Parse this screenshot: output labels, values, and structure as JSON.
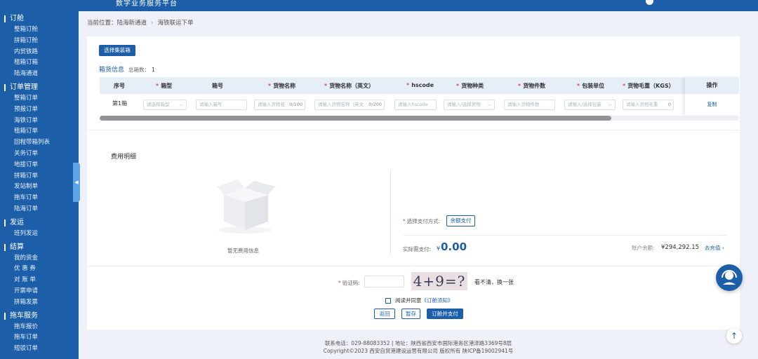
{
  "topbar": {
    "logo_text": "",
    "brand": "数字业务服务平台"
  },
  "sidebar": {
    "sections": [
      {
        "title": "订舱",
        "items": [
          "整箱订舱",
          "拼箱订舱",
          "内贸铁路",
          "租箱订箱",
          "陆海通道"
        ]
      },
      {
        "title": "订单管理",
        "items": [
          "整箱订单",
          "预报订单",
          "海铁订单",
          "租箱订单",
          "回程带箱列表",
          "关务订单",
          "地接订单",
          "拼箱订单",
          "发站制单",
          "拖车订单",
          "陆海订单"
        ]
      },
      {
        "title": "发运",
        "items": [
          "班列发运"
        ]
      },
      {
        "title": "结算",
        "items": [
          "我的资金",
          "优 惠 券",
          "对 账 单",
          "开票申请",
          "拼箱发票"
        ]
      },
      {
        "title": "拖车服务",
        "items": [
          "拖车报价",
          "拖车订单",
          "短驳订单"
        ]
      }
    ]
  },
  "breadcrumb": {
    "prefix": "当前位置：",
    "level1": "陆海新通道",
    "level2": "海铁联运下单"
  },
  "page": {
    "select_box_button": "选择集装箱",
    "box_info_title": "箱货信息",
    "box_count_label": "总箱数：",
    "box_count": "1"
  },
  "table": {
    "headers": [
      "序号",
      "箱型",
      "箱号",
      "货物名称",
      "货物名称（英文）",
      "hscode",
      "货物种类",
      "货物件数",
      "包装单位",
      "货物毛重（KGS）"
    ],
    "required": [
      false,
      true,
      false,
      true,
      true,
      true,
      true,
      true,
      true,
      true
    ],
    "op_header": "操作",
    "row": {
      "index": "第1箱",
      "box_type_placeholder": "请选择箱型",
      "box_no_placeholder": "请输入箱号",
      "goods_name_placeholder": "请输入货物名",
      "goods_name_count": "0/100",
      "goods_name_en_placeholder": "请输入货物名称（英文",
      "goods_name_en_count": "0/200",
      "hscode_placeholder": "请输入hscode",
      "goods_type_placeholder": "请输入/选择货物",
      "qty_placeholder": "请输入货物件数",
      "pack_placeholder": "请输入/选择包装",
      "weight_placeholder": "请输入货物毛重",
      "weight_trailing": "0",
      "copy": "复制"
    },
    "scroll_fraction": 0.8
  },
  "fees": {
    "title": "费用明细",
    "empty_text": "暂无费用信息"
  },
  "payment": {
    "method_label": "选择支付方式:",
    "method": "余额支付",
    "actual_label": "实际需支付:",
    "currency": "¥",
    "amount": "0.00",
    "balance_label": "账户余额:",
    "balance": "¥294,292.15",
    "recharge": "去充值 ›"
  },
  "verify": {
    "label": "验证码:",
    "captcha": "4+9=?",
    "refresh": "看不清，换一张"
  },
  "agree": {
    "text": "阅读并同意",
    "link": "《订舱须知》"
  },
  "buttons": {
    "back": "返回",
    "save": "暂存",
    "submit": "订舱并支付"
  },
  "footer": {
    "line1": "联系电话：029-88083352 | 地址：陕西省西安市国际港务区港泽路3369号8层",
    "line2": "Copyright©2023 西安自贸港建设运营有限公司 版权所有 陕ICP备19002941号"
  },
  "colors": {
    "primary": "#1c5fa8",
    "required": "#e34c4c"
  }
}
